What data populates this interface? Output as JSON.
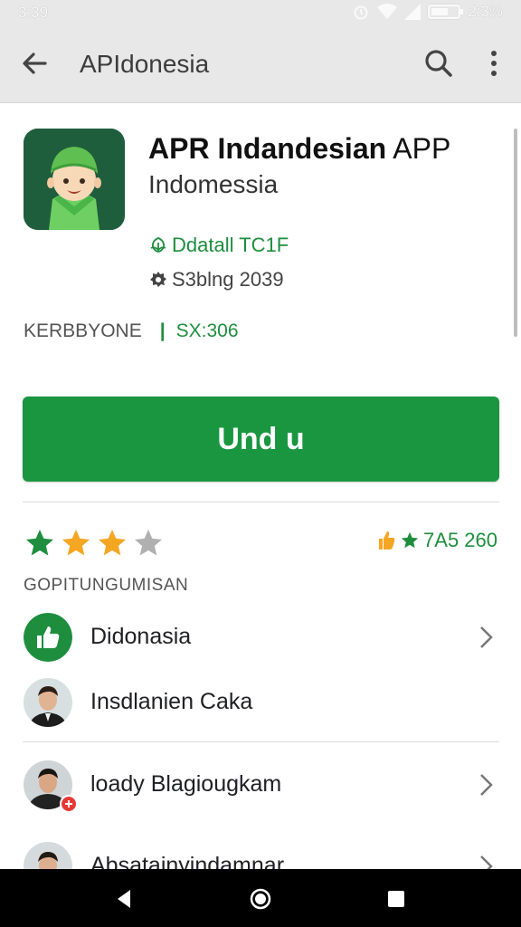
{
  "status_bar": {
    "time": "3:39",
    "battery_text": "2:3%"
  },
  "app_bar": {
    "title": "APIdonesia"
  },
  "app": {
    "name_bold": "APR Indandesian",
    "name_light": " APP",
    "developer": "Indomessia",
    "meta_primary": "Ddatall TC1F",
    "meta_secondary": "S3blng 2039"
  },
  "info": {
    "key": "KERBBYONE",
    "separator": "|",
    "value": "SX:306"
  },
  "install_button": {
    "label": "Und u"
  },
  "rating": {
    "stars_filled": 3,
    "stars_total": 4,
    "count_text": "7A5 260"
  },
  "section": {
    "title": "GOPITUNGUMISAN"
  },
  "list": [
    {
      "label": "Didonasia"
    },
    {
      "label": "Insdlanien Caka"
    },
    {
      "label": "loady Blagiougkam"
    },
    {
      "label": "Absatainyindamnar"
    }
  ],
  "colors": {
    "accent": "#1a9641",
    "star_gold": "#f5a623",
    "star_green": "#1e8e3e",
    "icon_bg": "#1f5e3c"
  }
}
